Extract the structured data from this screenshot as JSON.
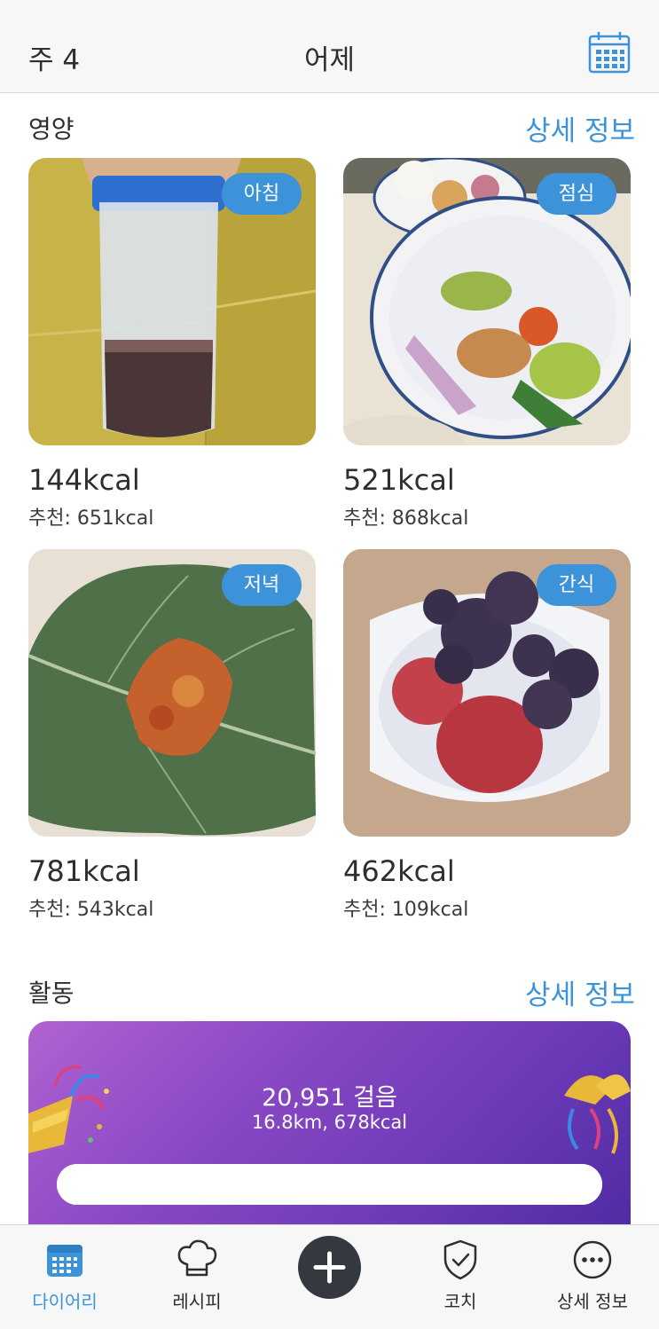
{
  "header": {
    "week_label": "주 4",
    "date_label": "어제",
    "calendar_icon": "calendar-icon"
  },
  "nutrition": {
    "title": "영양",
    "details_label": "상세 정보",
    "meals": [
      {
        "badge": "아침",
        "kcal": "144kcal",
        "recommended": "추천: 651kcal",
        "photo": "protein-shake-photo"
      },
      {
        "badge": "점심",
        "kcal": "521kcal",
        "recommended": "추천: 868kcal",
        "photo": "poke-bowl-photo"
      },
      {
        "badge": "저녁",
        "kcal": "781kcal",
        "recommended": "추천: 543kcal",
        "photo": "collard-wrap-photo"
      },
      {
        "badge": "간식",
        "kcal": "462kcal",
        "recommended": "추천: 109kcal",
        "photo": "yogurt-berries-photo"
      }
    ]
  },
  "activity": {
    "title": "활동",
    "details_label": "상세 정보",
    "steps": "20,951 걸음",
    "summary": "16.8km, 678kcal",
    "progress": 1.0
  },
  "tabbar": {
    "tabs": [
      {
        "label": "다이어리",
        "icon": "calendar-icon",
        "active": true
      },
      {
        "label": "레시피",
        "icon": "chef-hat-icon",
        "active": false
      },
      {
        "label": "",
        "icon": "plus-icon",
        "active": false
      },
      {
        "label": "코치",
        "icon": "shield-check-icon",
        "active": false
      },
      {
        "label": "상세 정보",
        "icon": "more-icon",
        "active": false
      }
    ]
  },
  "colors": {
    "accent": "#3d93d9",
    "activity_gradient_start": "#b063d0",
    "activity_gradient_end": "#4c2aa3",
    "add_button": "#34393f"
  }
}
